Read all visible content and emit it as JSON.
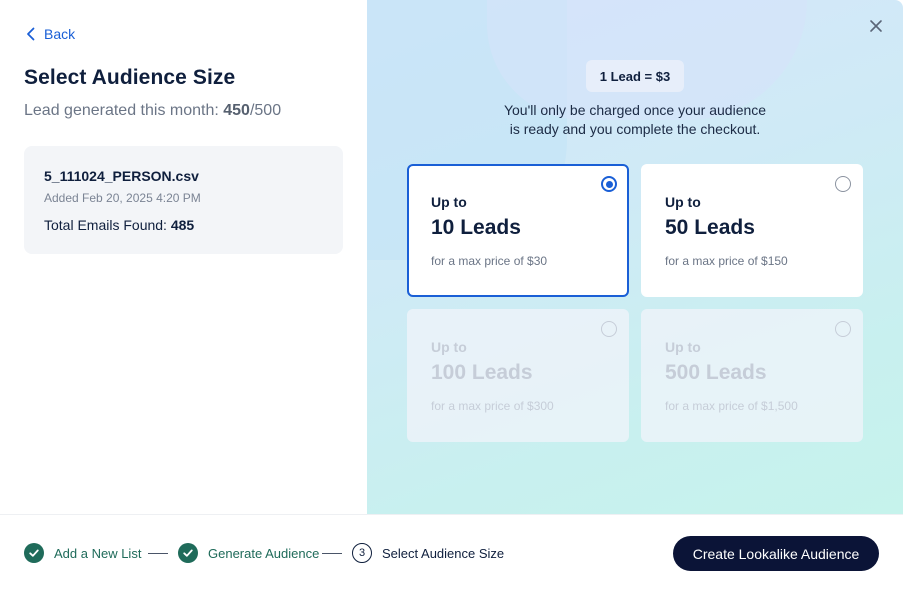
{
  "left": {
    "back_label": "Back",
    "title": "Select Audience Size",
    "lead_gen_prefix": "Lead generated this month: ",
    "lead_gen_used": "450",
    "lead_gen_total": "/500",
    "file": {
      "name": "5_111024_PERSON.csv",
      "added": "Added Feb 20, 2025 4:20 PM",
      "emails_label": "Total Emails Found: ",
      "emails_count": "485"
    }
  },
  "right": {
    "price_badge": "1 Lead = $3",
    "note_line1": "You'll only be charged once your audience",
    "note_line2": "is ready and you complete the checkout.",
    "options": [
      {
        "upto": "Up to",
        "leads": "10 Leads",
        "max": "for a max price of $30",
        "state": "selected"
      },
      {
        "upto": "Up to",
        "leads": "50 Leads",
        "max": "for a max price of $150",
        "state": "available"
      },
      {
        "upto": "Up to",
        "leads": "100 Leads",
        "max": "for a max price of $300",
        "state": "disabled"
      },
      {
        "upto": "Up to",
        "leads": "500 Leads",
        "max": "for a max price of $1,500",
        "state": "disabled"
      }
    ]
  },
  "footer": {
    "steps": [
      {
        "label": "Add a New List",
        "status": "done"
      },
      {
        "label": "Generate Audience",
        "status": "done"
      },
      {
        "number": "3",
        "label": "Select Audience Size",
        "status": "current"
      }
    ],
    "cta_label": "Create Lookalike Audience"
  },
  "icons": {
    "back": "chevron-left-icon",
    "close": "close-icon",
    "step_done": "check-icon"
  },
  "colors": {
    "accent": "#1a5fd6",
    "success": "#1f6b5a",
    "cta_bg": "#0b1437"
  }
}
